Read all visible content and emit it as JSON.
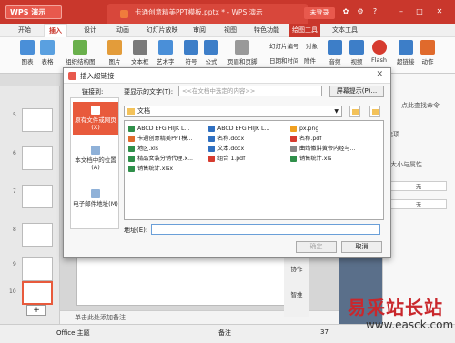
{
  "app": {
    "menu_label": "WPS 演示",
    "doc_tab": "卡通创意精美PPT模板.pptx * - WPS 演示",
    "login": "未登录"
  },
  "ribbon": {
    "tabs": [
      "开始",
      "插入",
      "设计",
      "动画",
      "幻灯片放映",
      "审阅",
      "视图",
      "特色功能",
      "绘图工具",
      "文本工具"
    ],
    "active_tab": "插入",
    "tools": [
      "图表",
      "表格",
      "组织结构图",
      "图片",
      "文本框",
      "艺术字",
      "符号",
      "公式",
      "页眉和页脚",
      "幻灯片编号",
      "日期和时间",
      "对象",
      "附件",
      "音频",
      "视频",
      "Flash",
      "超链接",
      "动作"
    ]
  },
  "slides": {
    "numbers": [
      "5",
      "6",
      "7",
      "8",
      "9",
      "10"
    ],
    "selected": "10"
  },
  "notes_placeholder": "单击此处添加备注",
  "side_tools": [
    "协作",
    "智推"
  ],
  "right_panel": {
    "header": "点此查找命令",
    "section": "选项",
    "size_label": "大小与属性",
    "none_1": "无",
    "none_2": "无"
  },
  "status": {
    "theme": "Office 主题",
    "notes": "备注",
    "zoom": "37"
  },
  "dialog": {
    "title": "插入超链接",
    "link_to_label": "链接到:",
    "display_text_label": "要显示的文字(T):",
    "display_text_placeholder": "<<在文档中选定的内容>>",
    "screen_tip_button": "屏幕提示(P)...",
    "nav": [
      {
        "label": "原有文件或网页(X)"
      },
      {
        "label": "本文档中的位置(A)"
      },
      {
        "label": "电子邮件地址(M)"
      }
    ],
    "folder": "文档",
    "files": [
      {
        "name": "ABCD  EFG  HIJK  L...",
        "type": "xls"
      },
      {
        "name": "ABCD  EFG  HIJK  L...",
        "type": "doc"
      },
      {
        "name": "px.png",
        "type": "png"
      },
      {
        "name": "卡通创意精美PPT模...",
        "type": "ppt"
      },
      {
        "name": "名称.docx",
        "type": "doc"
      },
      {
        "name": "名称.pdf",
        "type": "pdf"
      },
      {
        "name": "地区.xls",
        "type": "xls"
      },
      {
        "name": "文本.docx",
        "type": "doc"
      },
      {
        "name": "曲靖徽讲黄帝内经与...",
        "type": "txt"
      },
      {
        "name": "精品女装分销代理.x...",
        "type": "xls"
      },
      {
        "name": "组合 1.pdf",
        "type": "pdf"
      },
      {
        "name": "销售统计.xls",
        "type": "xls"
      },
      {
        "name": "销售统计.xlsx",
        "type": "xls"
      }
    ],
    "address_label": "地址(E):",
    "ok": "确定",
    "cancel": "取消"
  },
  "watermark": {
    "text": "易采站长站",
    "url": "www.easck.com"
  }
}
